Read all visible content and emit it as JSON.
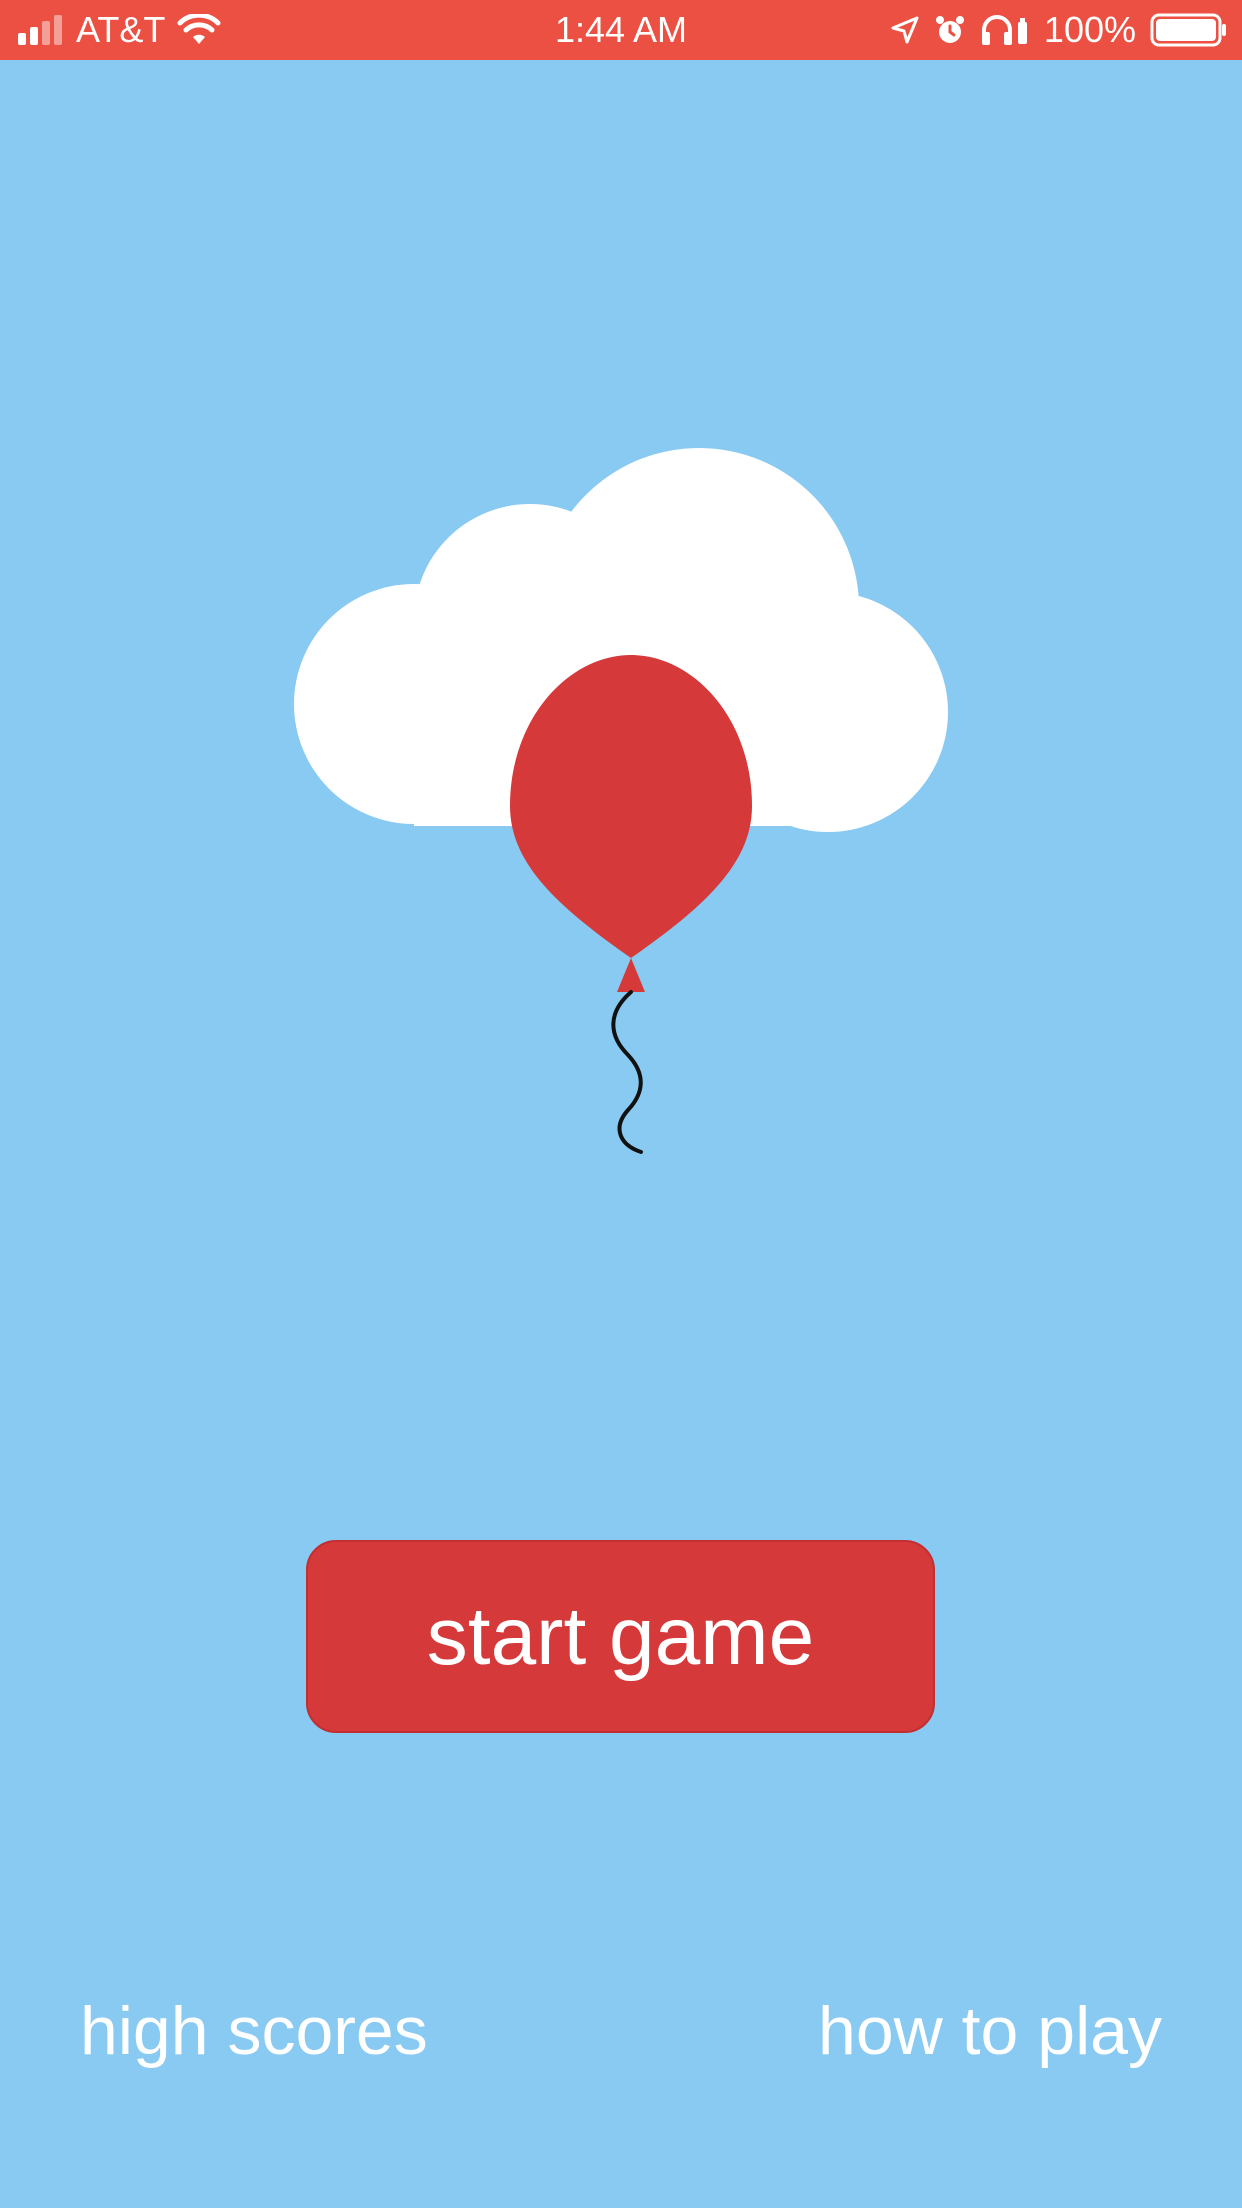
{
  "status_bar": {
    "carrier": "AT&T",
    "time": "1:44 AM",
    "battery_percent": "100%",
    "signal_bars_active": 2,
    "signal_bars_total": 4,
    "battery_level": 1.0,
    "icons": [
      "signal-icon",
      "wifi-icon",
      "location-icon",
      "alarm-icon",
      "headphones-icon",
      "battery-icon"
    ]
  },
  "illustration": {
    "items": [
      "cloud-icon",
      "balloon-icon"
    ],
    "colors": {
      "cloud": "#ffffff",
      "balloon": "#d5393a",
      "string": "#111111"
    }
  },
  "menu": {
    "start_label": "start game",
    "high_scores_label": "high scores",
    "how_to_play_label": "how to play"
  },
  "theme": {
    "background": "#88caf2",
    "status_bar": "#ec5042",
    "button": "#d5393a",
    "text": "#ffffff"
  }
}
